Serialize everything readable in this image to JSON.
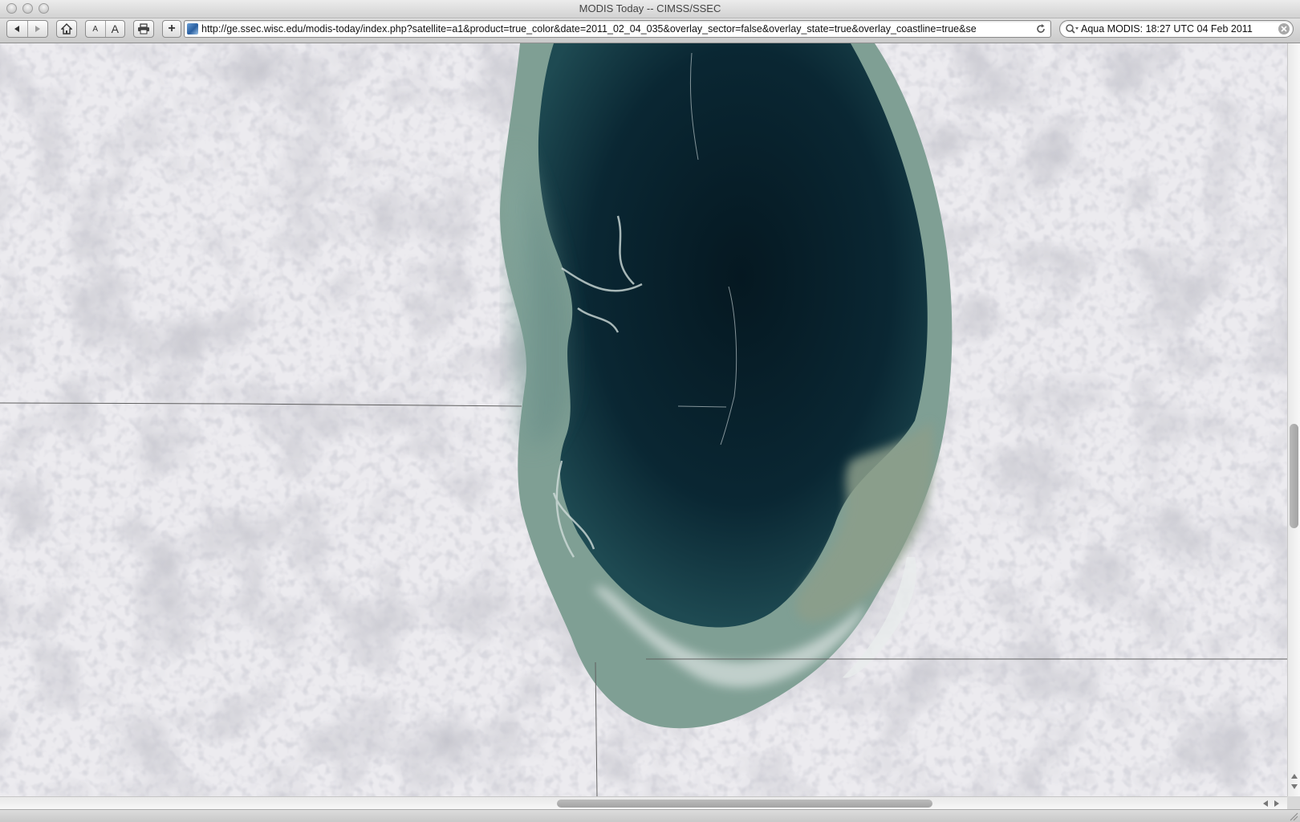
{
  "window": {
    "title": "MODIS Today -- CIMSS/SSEC"
  },
  "toolbar": {
    "back_icon": "back-arrow-icon",
    "forward_icon": "forward-arrow-icon",
    "home_icon": "home-icon",
    "text_smaller_label": "A",
    "text_bigger_label": "A",
    "print_icon": "printer-icon",
    "add_bookmark_label": "+"
  },
  "address_bar": {
    "url": "http://ge.ssec.wisc.edu/modis-today/index.php?satellite=a1&product=true_color&date=2011_02_04_035&overlay_sector=false&overlay_state=true&overlay_coastline=true&se"
  },
  "search_bar": {
    "value": "Aqua  MODIS: 18:27 UTC 04 Feb 2011"
  },
  "colors": {
    "lake_deep": "#07202c",
    "lake_sediment": "#8aa79a",
    "snow_land": "#ecebef",
    "border_line": "#555555"
  }
}
